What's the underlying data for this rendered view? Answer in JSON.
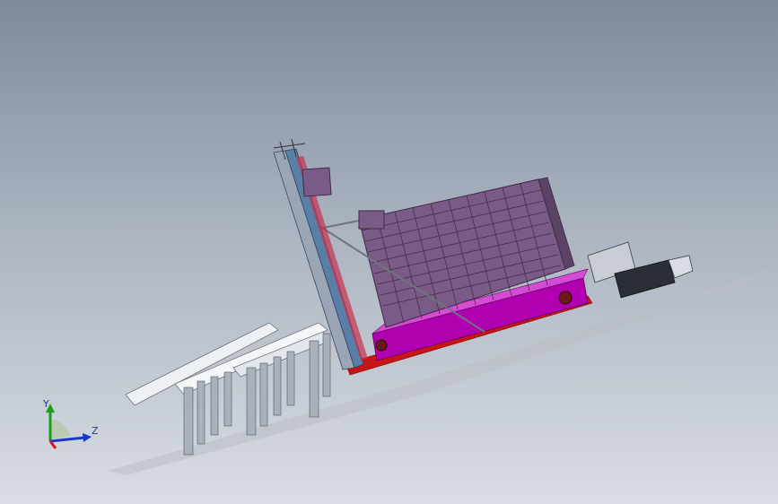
{
  "viewport": {
    "background_top": "#7f8a9a",
    "background_bottom": "#d9dde3"
  },
  "model": {
    "frame_color": "#b000b0",
    "rail_color": "#c81414",
    "shelf_color": "#7a5a86",
    "mast_color": "#5a7fa6",
    "conveyor_color": "#eef0f4"
  },
  "triad": {
    "y_label": "Y",
    "z_label": "Z",
    "x_color": "#d01818",
    "y_color": "#18a018",
    "z_color": "#1a38d0"
  }
}
